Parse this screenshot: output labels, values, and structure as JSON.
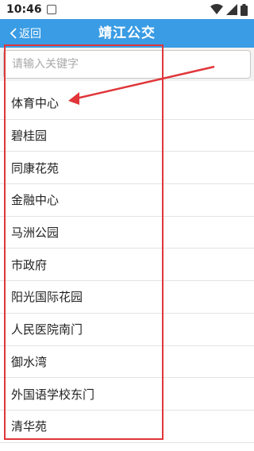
{
  "status_bar": {
    "time": "10:46"
  },
  "header": {
    "back_label": "返回",
    "title": "靖江公交"
  },
  "search": {
    "placeholder": "请输入关键字",
    "value": ""
  },
  "stops": [
    "体育中心",
    "碧桂园",
    "同康花苑",
    "金融中心",
    "马洲公园",
    "市政府",
    "阳光国际花园",
    "人民医院南门",
    "御水湾",
    "外国语学校东门",
    "清华苑"
  ],
  "colors": {
    "header": "#3a9ce4",
    "annotation": "#e0363a"
  },
  "icons": [
    "sim-card-icon",
    "wifi-icon",
    "signal-icon",
    "battery-icon",
    "chevron-left-icon",
    "annotation-arrow-icon"
  ]
}
